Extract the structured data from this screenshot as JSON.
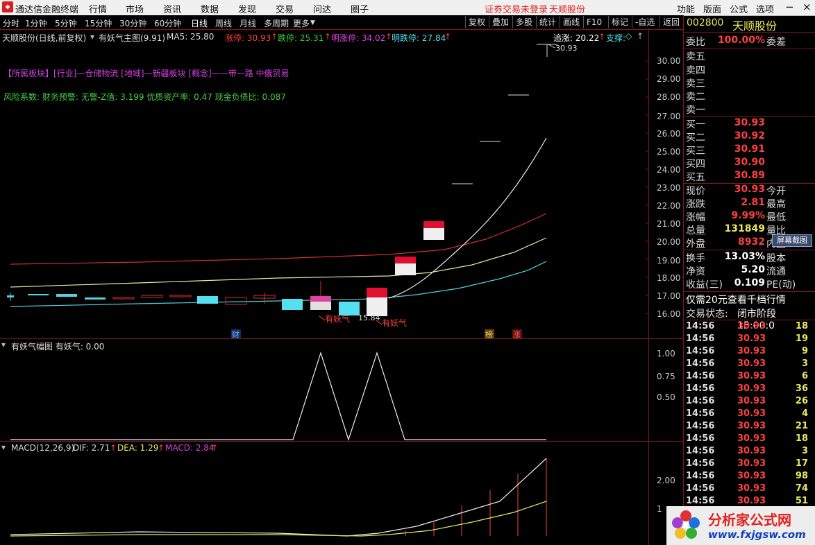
{
  "menu": {
    "app_title": "通达信金融终端",
    "items": [
      "行情",
      "市场",
      "资讯",
      "数据",
      "发现",
      "交易",
      "问达",
      "圈子"
    ],
    "login_status": "证券交易未登录",
    "stock_name": "天顺股份",
    "right_items": [
      "功能",
      "版面",
      "公式",
      "选项"
    ]
  },
  "toolbar": {
    "periods": [
      "分时",
      "1分钟",
      "5分钟",
      "15分钟",
      "30分钟",
      "60分钟",
      "日线",
      "周线",
      "月线",
      "多周期",
      "更多"
    ],
    "actions": [
      "复权",
      "叠加",
      "多股",
      "统计",
      "画线",
      "F10",
      "标记",
      "-自选",
      "返回"
    ]
  },
  "main_info": {
    "title": "天顺股份(日线,前复权)",
    "indicator": "有妖气主图(9.91)",
    "ma5": "MA5: 25.80",
    "zhangting": "涨停: 30.93",
    "dieting": "跌停: 25.31",
    "ming_zhangting": "明涨停: 34.02",
    "ming_dieting": "明跌停: 27.84",
    "zhuizhang": "追涨: 20.22",
    "zhicheng": "支撑:",
    "sector_line": "【所属板块】[行业]—仓储物流 [地域]—新疆板块 [概念]——带一路 中俄贸易",
    "risk_line": "风险系数: 财务预警: 无警-Z值: 3.199 优质资产率: 0.47 现金负债比: 0.087",
    "peak_label": "30.93",
    "low_label": "15.84",
    "signal_label": "有妖气",
    "marks": [
      "财",
      "榜",
      "涨"
    ]
  },
  "price_axis": [
    "30.00",
    "29.00",
    "28.00",
    "27.00",
    "26.00",
    "25.00",
    "24.00",
    "23.00",
    "22.00",
    "21.00",
    "20.00",
    "19.00",
    "18.00",
    "17.00",
    "16.00"
  ],
  "sub1": {
    "title": "有妖气幅图 有妖气: 0.00",
    "axis": [
      "1.00",
      "0.75",
      "0.50"
    ]
  },
  "sub2": {
    "title": "MACD(12,26,9)",
    "dif": "DIF: 2.71",
    "dea": "DEA: 1.29",
    "macd": "MACD: 2.84",
    "axis": [
      "2.00",
      "1"
    ]
  },
  "quote": {
    "code": "002800",
    "name": "天顺股份",
    "weibi_label": "委比",
    "weibi": "100.00%",
    "weicha_label": "委差",
    "sell": [
      "卖五",
      "卖四",
      "卖三",
      "卖二",
      "卖一"
    ],
    "buy": [
      {
        "label": "买一",
        "price": "30.93"
      },
      {
        "label": "买二",
        "price": "30.92"
      },
      {
        "label": "买三",
        "price": "30.91"
      },
      {
        "label": "买四",
        "price": "30.90"
      },
      {
        "label": "买五",
        "price": "30.89"
      }
    ],
    "stats": [
      {
        "l1": "现价",
        "v": "30.93",
        "l2": "今开",
        "color": "#ff4040"
      },
      {
        "l1": "涨跌",
        "v": "2.81",
        "l2": "最高",
        "color": "#ff4040"
      },
      {
        "l1": "涨幅",
        "v": "9.99%",
        "l2": "最低",
        "color": "#ff4040"
      },
      {
        "l1": "总量",
        "v": "131849",
        "l2": "量比",
        "color": "#e8e85a"
      },
      {
        "l1": "外盘",
        "v": "8932",
        "l2": "内盘",
        "color": "#ff4040"
      }
    ],
    "screenshot_btn": "屏幕截图",
    "stats2": [
      {
        "l1": "换手",
        "v": "13.03%",
        "l2": "股本"
      },
      {
        "l1": "净资",
        "v": "5.20",
        "l2": "流通"
      },
      {
        "l1": "收益(三)",
        "v": "0.109",
        "l2": "PE(动)"
      }
    ],
    "promo": "仅需20元查看千档行情",
    "state_label": "交易状态:",
    "state": "闭市阶段 15:00:0",
    "ticks": [
      {
        "t": "14:56",
        "p": "30.93",
        "v": "18"
      },
      {
        "t": "14:56",
        "p": "30.93",
        "v": "19"
      },
      {
        "t": "14:56",
        "p": "30.93",
        "v": "9"
      },
      {
        "t": "14:56",
        "p": "30.93",
        "v": "3"
      },
      {
        "t": "14:56",
        "p": "30.93",
        "v": "6"
      },
      {
        "t": "14:56",
        "p": "30.93",
        "v": "36"
      },
      {
        "t": "14:56",
        "p": "30.93",
        "v": "26"
      },
      {
        "t": "14:56",
        "p": "30.93",
        "v": "4"
      },
      {
        "t": "14:56",
        "p": "30.93",
        "v": "21"
      },
      {
        "t": "14:56",
        "p": "30.93",
        "v": "18"
      },
      {
        "t": "14:56",
        "p": "30.93",
        "v": "3"
      },
      {
        "t": "14:56",
        "p": "30.93",
        "v": "17"
      },
      {
        "t": "14:56",
        "p": "30.93",
        "v": "98"
      },
      {
        "t": "14:56",
        "p": "30.93",
        "v": "74"
      },
      {
        "t": "14:56",
        "p": "30.93",
        "v": "51"
      }
    ]
  },
  "watermark": {
    "name": "分析家公式网",
    "url": "www.fxjgsw.com"
  }
}
